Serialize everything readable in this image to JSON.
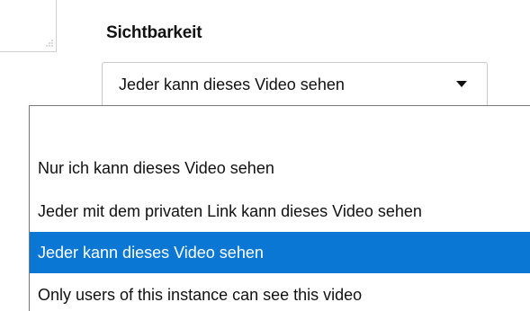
{
  "visibility": {
    "label": "Sichtbarkeit",
    "selected_value": "Jeder kann dieses Video sehen",
    "options": [
      {
        "label": ""
      },
      {
        "label": "Nur ich kann dieses Video sehen"
      },
      {
        "label": "Jeder mit dem privaten Link kann dieses Video sehen"
      },
      {
        "label": "Jeder kann dieses Video sehen",
        "highlighted": true
      },
      {
        "label": "Only users of this instance can see this video"
      }
    ],
    "highlight_color": "#0a77d5"
  },
  "icons": {
    "resize_grip": "resize-grip-icon",
    "dropdown_arrow": "chevron-down-icon"
  }
}
